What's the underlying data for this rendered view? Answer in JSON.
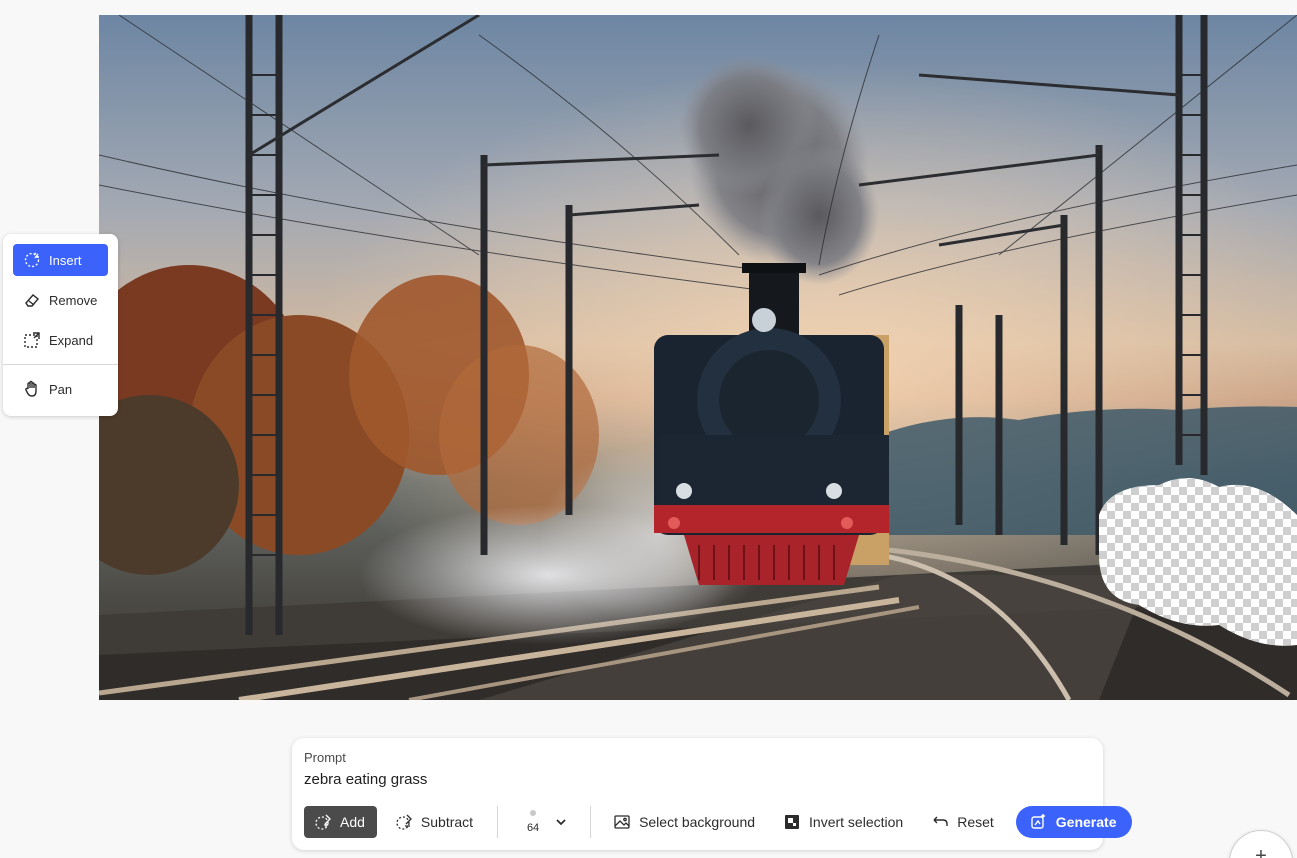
{
  "tools": {
    "items": [
      {
        "label": "Insert",
        "icon": "insert-icon",
        "active": true
      },
      {
        "label": "Remove",
        "icon": "eraser-icon",
        "active": false
      },
      {
        "label": "Expand",
        "icon": "expand-icon",
        "active": false
      },
      {
        "label": "Pan",
        "icon": "hand-icon",
        "active": false
      }
    ]
  },
  "prompt": {
    "label": "Prompt",
    "value": "zebra eating grass"
  },
  "toolbar": {
    "add_label": "Add",
    "subtract_label": "Subtract",
    "brush_size": "64",
    "select_background_label": "Select background",
    "invert_selection_label": "Invert selection",
    "reset_label": "Reset",
    "generate_label": "Generate"
  },
  "colors": {
    "accent": "#3b63fb",
    "dark_button": "#4b4b4b",
    "background": "#f8f8f8"
  }
}
